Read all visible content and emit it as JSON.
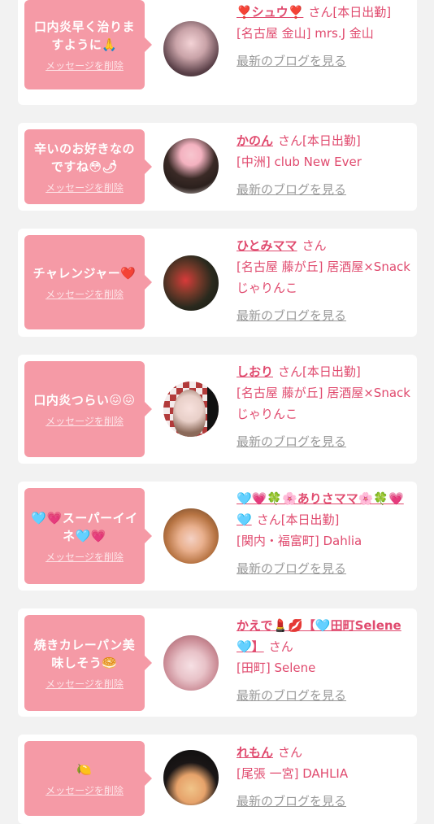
{
  "colors": {
    "accent": "#e04a6e",
    "bubble": "#f59aa6",
    "muted": "#999999"
  },
  "delete_label": "メッセージを削除",
  "blog_label": "最新のブログを見る",
  "san": "さん",
  "cards": [
    {
      "message": "口内炎早く治りますように🙏",
      "name": "❣️シュウ❣️",
      "status": "[本日出勤]",
      "shop": "[名古屋 金山] mrs.J 金山"
    },
    {
      "message": "辛いのお好きなのですね😳🌶",
      "name": "かのん",
      "status": "[本日出勤]",
      "shop": "[中洲] club New Ever"
    },
    {
      "message": "チャレンジャー❤️",
      "name": "ひとみママ",
      "status": "",
      "shop": "[名古屋 藤が丘] 居酒屋×Snack じゃりんこ"
    },
    {
      "message": "口内炎つらい😖😖",
      "name": "しおり",
      "status": "[本日出勤]",
      "shop": "[名古屋 藤が丘] 居酒屋×Snack じゃりんこ"
    },
    {
      "message": "🩵💗スーパーイイネ🩵💗",
      "name": "🩵💗🍀🌸ありさママ🌸🍀💗🩵",
      "status": "[本日出勤]",
      "shop": "[関内・福富町] Dahlia"
    },
    {
      "message": "焼きカレーパン美味しそう🥯",
      "name": "かえで💄💋【🩵田町Selene🩵】",
      "status": "",
      "shop": "[田町] Selene"
    },
    {
      "message": "🍋",
      "name": "れもん",
      "status": "",
      "shop": "[尾張 一宮] DAHLIA"
    }
  ]
}
